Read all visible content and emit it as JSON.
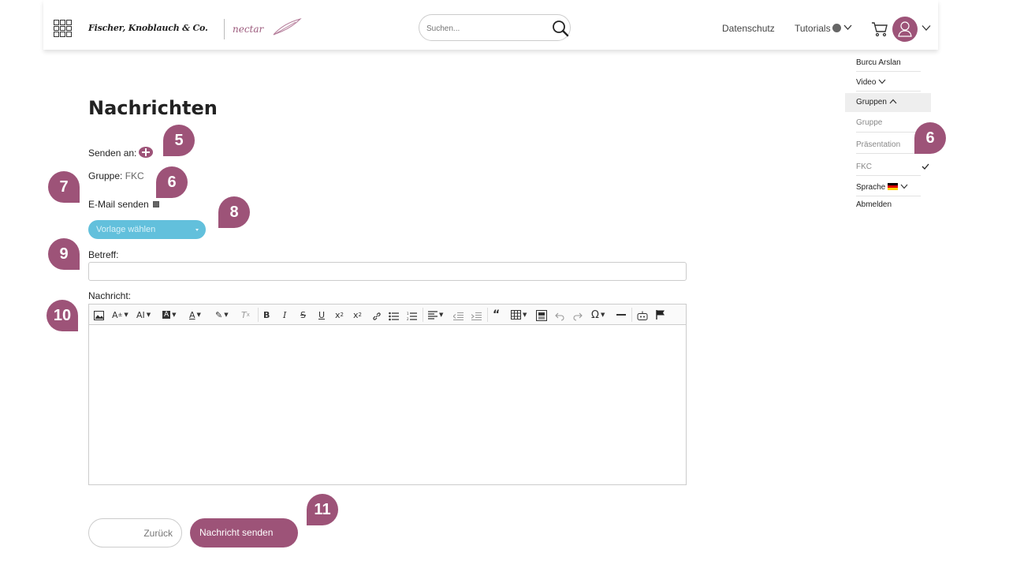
{
  "header": {
    "brand": "Fischer, Knoblauch & Co.",
    "sub_brand": "nectar",
    "search_placeholder": "Suchen...",
    "nav": {
      "privacy": "Datenschutz",
      "tutorials": "Tutorials"
    }
  },
  "dropdown": {
    "user_name": "Burcu Arslan",
    "video": "Video",
    "groups": "Gruppen",
    "group_items": [
      "Gruppe",
      "Präsentation",
      "FKC"
    ],
    "language": "Sprache",
    "logout": "Abmelden"
  },
  "page": {
    "title": "Nachrichten",
    "send_to_label": "Senden an:",
    "group_label": "Gruppe:",
    "group_value": "FKC",
    "email_label": "E-Mail senden",
    "template_placeholder": "Vorlage wählen",
    "subject_label": "Betreff:",
    "subject_value": "",
    "message_label": "Nachricht:",
    "back_label": "Zurück",
    "send_label": "Nachricht senden"
  },
  "toolbar": {
    "bold": "B",
    "italic": "I",
    "strike": "S",
    "underline": "U",
    "special_char": "Ω"
  },
  "callouts": {
    "c5": "5",
    "c6a": "6",
    "c6b": "6",
    "c7": "7",
    "c8": "8",
    "c9": "9",
    "c10": "10",
    "c11": "11"
  },
  "colors": {
    "accent": "#9d5378",
    "template_button": "#62c0dc"
  }
}
